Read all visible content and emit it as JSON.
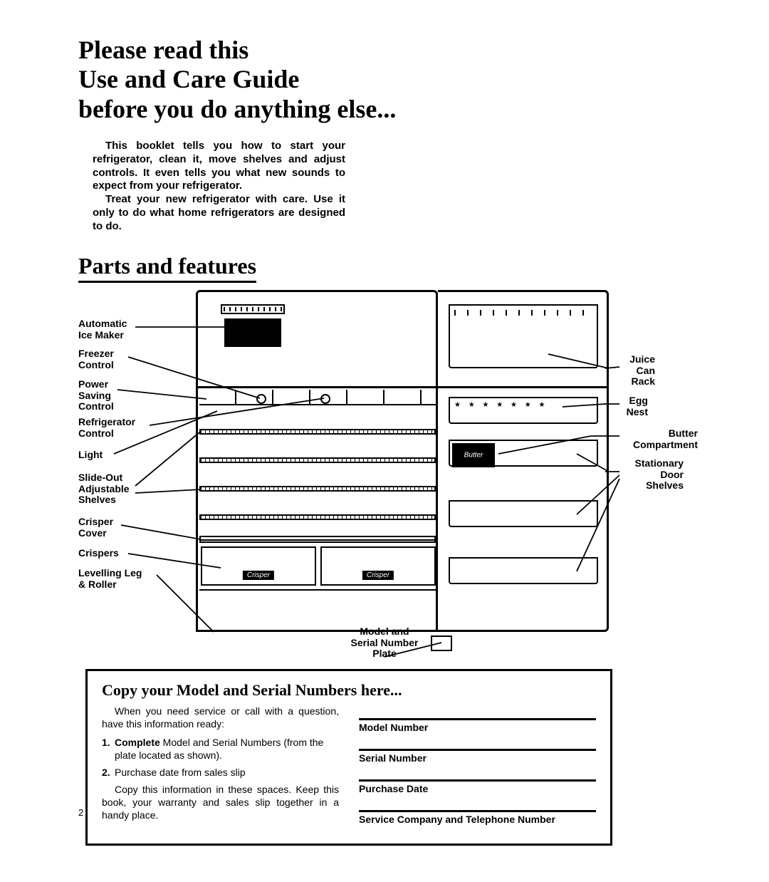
{
  "title_line1": "Please read this",
  "title_line2": "Use and Care Guide",
  "title_line3": "before you do anything else...",
  "intro_p1": "This booklet tells you how to start your refrigerator, clean it, move shelves and adjust controls. It even tells you what new sounds to expect from your refrigerator.",
  "intro_p2": "Treat your new refrigerator with care. Use it only to do what home refrigerators are designed to do.",
  "section_parts": "Parts and features",
  "labels": {
    "ice_maker": "Automatic\nIce Maker",
    "freezer_control": "Freezer\nControl",
    "power_saving": "Power\nSaving\nControl",
    "refrig_control": "Refrigerator\nControl",
    "light": "Light",
    "shelves": "Slide-Out\nAdjustable\nShelves",
    "crisper_cover": "Crisper\nCover",
    "crispers": "Crispers",
    "levelling": "Levelling Leg\n& Roller",
    "juice_rack": "Juice\nCan\nRack",
    "egg_nest": "Egg\nNest",
    "butter_comp": "Butter\nCompartment",
    "door_shelves": "Stationary\nDoor\nShelves",
    "plate": "Model and\nSerial Number\nPlate",
    "crisper_tag": "Crisper",
    "butter_tag": "Butter"
  },
  "info": {
    "heading": "Copy your Model and Serial Numbers here...",
    "p1": "When you need service or call with a question, have this information ready:",
    "li1_bold": "Complete",
    "li1_rest": " Model and Serial Numbers (from the plate located as shown).",
    "li2": "Purchase date from sales slip",
    "p2": "Copy this information in these spaces. Keep this book, your warranty and sales slip together in a handy place.",
    "fields": {
      "model": "Model Number",
      "serial": "Serial Number",
      "purchase": "Purchase Date",
      "service": "Service Company and Telephone Number"
    }
  },
  "page_number": "2"
}
